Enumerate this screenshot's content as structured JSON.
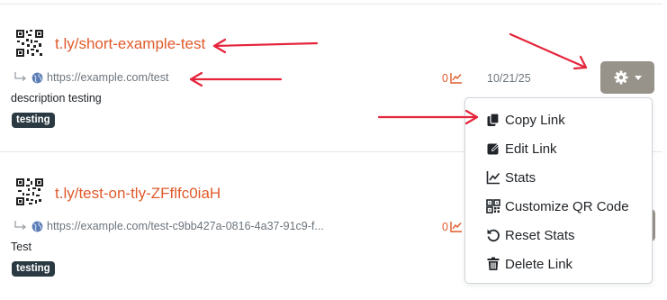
{
  "links": [
    {
      "short_url": "t.ly/short-example-test",
      "original_url": "https://example.com/test",
      "description": "description testing",
      "tag": "testing",
      "clicks": "0",
      "date": "10/21/25"
    },
    {
      "short_url": "t.ly/test-on-tly-ZFflfc0iaH",
      "original_url": "https://example.com/test-c9bb427a-0816-4a37-91c9-f...",
      "description": "Test",
      "tag": "testing",
      "clicks": "0"
    }
  ],
  "menu": {
    "items": [
      {
        "label": "Copy Link",
        "icon": "copy-icon"
      },
      {
        "label": "Edit Link",
        "icon": "edit-icon"
      },
      {
        "label": "Stats",
        "icon": "chart-icon"
      },
      {
        "label": "Customize QR Code",
        "icon": "qr-code-icon"
      },
      {
        "label": "Reset Stats",
        "icon": "reset-icon"
      },
      {
        "label": "Delete Link",
        "icon": "trash-icon"
      }
    ]
  },
  "colors": {
    "link": "#e05a2b",
    "button": "#98938a",
    "badge": "#2b3a42",
    "annotation_arrow": "#e5243b"
  }
}
